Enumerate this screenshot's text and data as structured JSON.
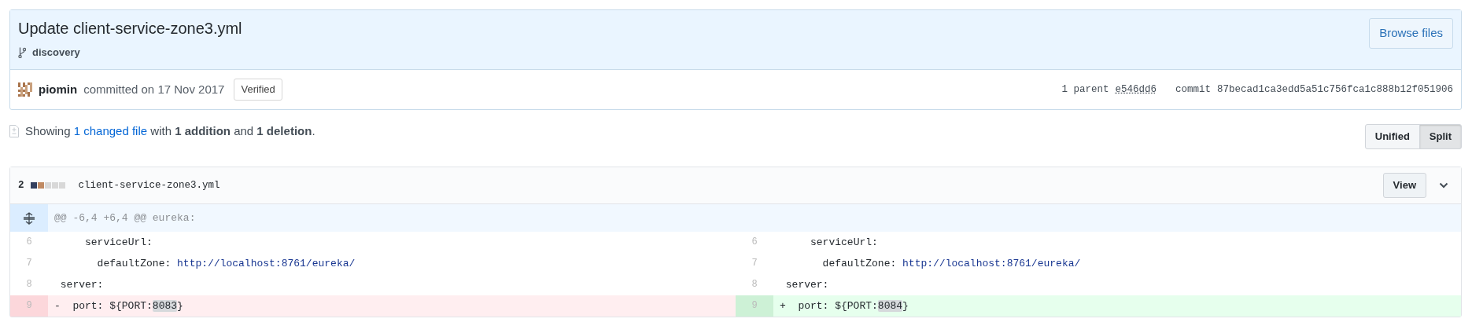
{
  "commit": {
    "title": "Update client-service-zone3.yml",
    "branch": "discovery",
    "browse_button": "Browse files",
    "author": "piomin",
    "committed_text": "committed on 17 Nov 2017",
    "verified_badge": "Verified",
    "parents_text": "1 parent",
    "parent_sha": "e546dd6",
    "commit_label": "commit",
    "commit_sha": "87becad1ca3edd5a51c756fca1c888b12f051906"
  },
  "summary": {
    "prefix": "Showing",
    "link": "1 changed file",
    "rest": "with **1 addition** and **1 deletion**."
  },
  "view_toggle": [
    {
      "label": "Unified",
      "selected": false
    },
    {
      "label": "Split",
      "selected": true
    }
  ],
  "file": {
    "changes": "2",
    "diffstat": [
      {
        "color": "#34405e"
      },
      {
        "color": "#c08a63"
      },
      {
        "color": "#d8d8d8"
      },
      {
        "color": "#d8d8d8"
      },
      {
        "color": "#d8d8d8"
      }
    ],
    "name": "client-service-zone3.yml",
    "view_button": "View",
    "expanded": true,
    "hunk_header": "@@ -6,4 +6,4 @@ eureka:",
    "rows": [
      {
        "left": {
          "number": "6",
          "kind": "context",
          "segments": [
            {
              "text": "    serviceUrl:",
              "kind": "plain"
            }
          ]
        },
        "right": {
          "number": "6",
          "kind": "context",
          "segments": [
            {
              "text": "    serviceUrl:",
              "kind": "plain"
            }
          ]
        }
      },
      {
        "left": {
          "number": "7",
          "kind": "context",
          "segments": [
            {
              "text": "      defaultZone: ",
              "kind": "plain"
            },
            {
              "text": "http://localhost:8761/eureka/",
              "kind": "string"
            }
          ]
        },
        "right": {
          "number": "7",
          "kind": "context",
          "segments": [
            {
              "text": "      defaultZone: ",
              "kind": "plain"
            },
            {
              "text": "http://localhost:8761/eureka/",
              "kind": "string"
            }
          ]
        }
      },
      {
        "left": {
          "number": "8",
          "kind": "context",
          "segments": [
            {
              "text": "server:",
              "kind": "plain"
            }
          ]
        },
        "right": {
          "number": "8",
          "kind": "context",
          "segments": [
            {
              "text": "server:",
              "kind": "plain"
            }
          ]
        }
      },
      {
        "left": {
          "number": "9",
          "kind": "deletion",
          "marker": "-",
          "segments": [
            {
              "text": "port: ${PORT:",
              "kind": "plain"
            },
            {
              "text": "8083",
              "kind": "highlight"
            },
            {
              "text": "}",
              "kind": "plain"
            }
          ]
        },
        "right": {
          "number": "9",
          "kind": "addition",
          "marker": "+",
          "segments": [
            {
              "text": "port: ${PORT:",
              "kind": "plain"
            },
            {
              "text": "8084",
              "kind": "highlight"
            },
            {
              "text": "}",
              "kind": "plain"
            }
          ]
        }
      }
    ]
  }
}
